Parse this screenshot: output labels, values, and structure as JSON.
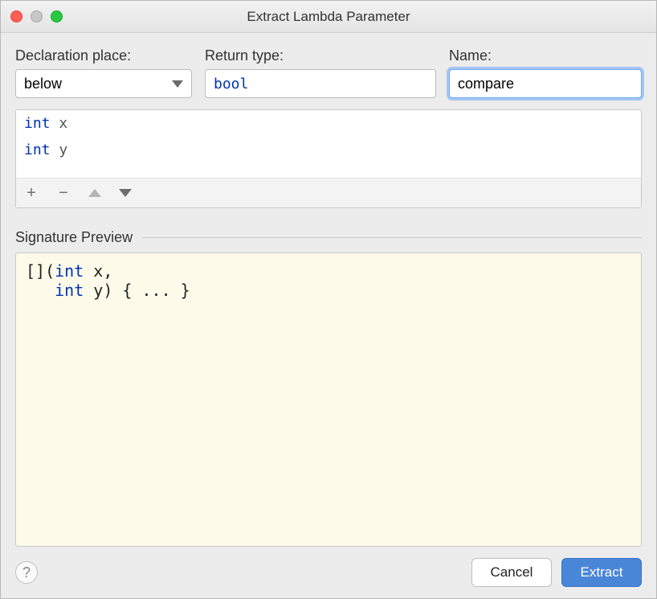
{
  "window": {
    "title": "Extract Lambda Parameter"
  },
  "fields": {
    "declaration": {
      "label": "Declaration place:",
      "value": "below"
    },
    "returnType": {
      "label": "Return type:",
      "value": "bool"
    },
    "name": {
      "label": "Name:",
      "value": "compare"
    }
  },
  "params": [
    {
      "type": "int",
      "name": "x"
    },
    {
      "type": "int",
      "name": "y"
    }
  ],
  "toolbar": {
    "add": "+",
    "remove": "−"
  },
  "preview": {
    "label": "Signature Preview",
    "line1_pre": "[](",
    "line1_kw": "int",
    "line1_post": " x,",
    "line2_pre": "   ",
    "line2_kw": "int",
    "line2_post": " y) { ... }"
  },
  "buttons": {
    "help": "?",
    "cancel": "Cancel",
    "extract": "Extract"
  }
}
